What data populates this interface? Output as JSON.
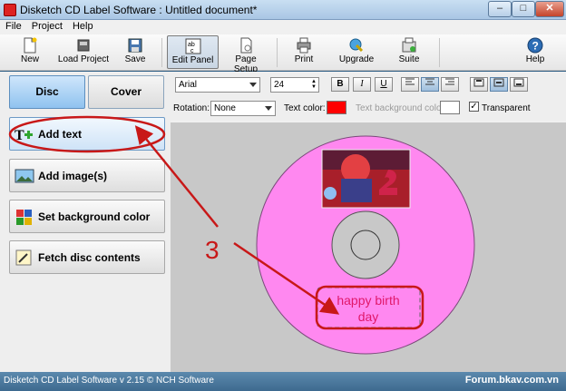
{
  "window": {
    "title": "Disketch CD Label Software : Untitled document*",
    "min": "–",
    "max": "□",
    "close": "✕"
  },
  "menu": [
    "File",
    "Project",
    "Help"
  ],
  "toolbar": {
    "new": "New",
    "load_project": "Load Project",
    "save": "Save",
    "edit_panel": "Edit Panel",
    "page_setup": "Page Setup",
    "print": "Print",
    "upgrade": "Upgrade",
    "suite": "Suite",
    "help": "Help"
  },
  "tabs": {
    "disc": "Disc",
    "cover": "Cover"
  },
  "actions": {
    "add_text": "Add text",
    "add_images": "Add image(s)",
    "set_background": "Set background color",
    "fetch_contents": "Fetch disc contents"
  },
  "props": {
    "font": "Arial",
    "size": "24",
    "bold": "B",
    "italic": "I",
    "underline": "U",
    "rotation_label": "Rotation:",
    "rotation_value": "None",
    "text_color_label": "Text color:",
    "text_bg_label": "Text background color:",
    "transparent_label": "Transparent",
    "transparent_checked": "✓",
    "text_color": "#ff0000"
  },
  "disc": {
    "label_text_line1": "happy birth",
    "label_text_line2": "day",
    "label_color": "#ff88f0",
    "text_color": "#e0186a"
  },
  "annotation": {
    "number": "3"
  },
  "status": {
    "text": "Disketch CD Label Software v 2.15 © NCH Software",
    "watermark": "Forum.bkav.com.vn"
  }
}
